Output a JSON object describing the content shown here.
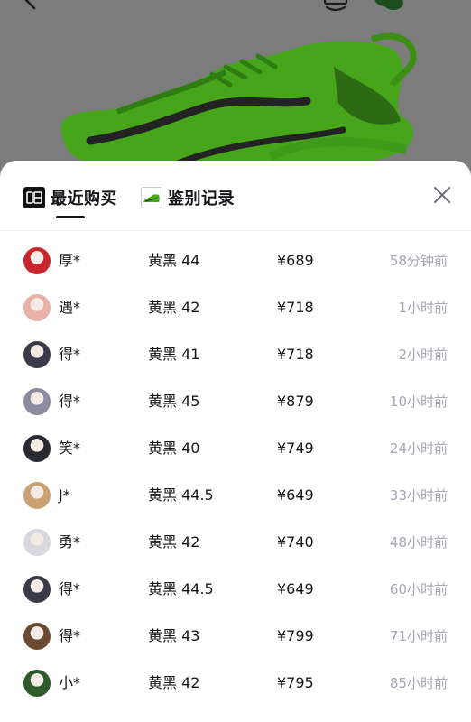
{
  "topbar": {
    "back_icon": "chevron-left-icon",
    "brand_icon": "brand-logo-icon",
    "share_icon": "wechat-icon",
    "more_icon": "more-dots-icon"
  },
  "sheet": {
    "tabs": [
      {
        "label": "最近购买",
        "icon": "dewu-logo-icon",
        "active": true
      },
      {
        "label": "鉴别记录",
        "icon": "shoe-thumbnail-icon",
        "active": false
      }
    ],
    "close_icon": "close-icon",
    "accent_color": "#16161a",
    "muted_color": "#a6a6b2"
  },
  "purchases": [
    {
      "name": "厚*",
      "size": "黄黑 44",
      "price": "¥689",
      "time": "58分钟前",
      "avatar_color": "#c8272d"
    },
    {
      "name": "遇*",
      "size": "黄黑 42",
      "price": "¥718",
      "time": "1小时前",
      "avatar_color": "#e8b3a6"
    },
    {
      "name": "得*",
      "size": "黄黑 41",
      "price": "¥718",
      "time": "2小时前",
      "avatar_color": "#3a3a48"
    },
    {
      "name": "得*",
      "size": "黄黑 45",
      "price": "¥879",
      "time": "10小时前",
      "avatar_color": "#8d8ba0"
    },
    {
      "name": "笑*",
      "size": "黄黑 40",
      "price": "¥749",
      "time": "24小时前",
      "avatar_color": "#2a2a33"
    },
    {
      "name": "J*",
      "size": "黄黑 44.5",
      "price": "¥649",
      "time": "33小时前",
      "avatar_color": "#c9a173"
    },
    {
      "name": "勇*",
      "size": "黄黑 42",
      "price": "¥740",
      "time": "48小时前",
      "avatar_color": "#d7d7de"
    },
    {
      "name": "得*",
      "size": "黄黑 44.5",
      "price": "¥649",
      "time": "60小时前",
      "avatar_color": "#3a3a48"
    },
    {
      "name": "得*",
      "size": "黄黑 43",
      "price": "¥799",
      "time": "71小时前",
      "avatar_color": "#6b4a33"
    },
    {
      "name": "小*",
      "size": "黄黑 42",
      "price": "¥795",
      "time": "85小时前",
      "avatar_color": "#2f5a2c"
    }
  ]
}
